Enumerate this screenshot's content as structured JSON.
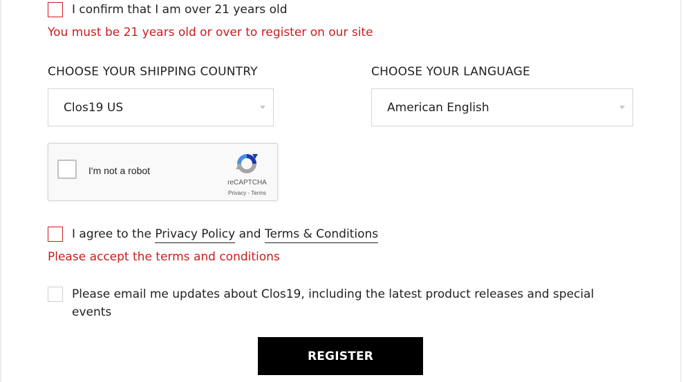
{
  "age_confirm": {
    "label": "I confirm that I am over 21 years old",
    "error": "You must be 21 years old or over to register on our site"
  },
  "shipping_country": {
    "heading": "CHOOSE YOUR SHIPPING COUNTRY",
    "selected": "Clos19 US"
  },
  "language": {
    "heading": "CHOOSE YOUR LANGUAGE",
    "selected": "American English"
  },
  "recaptcha": {
    "label": "I'm not a robot",
    "brand": "reCAPTCHA",
    "privacy": "Privacy",
    "separator": " - ",
    "terms": "Terms",
    "icon": "recaptcha-logo-icon"
  },
  "terms_agree": {
    "prefix": "I agree to the ",
    "privacy_link": "Privacy Policy",
    "middle": " and ",
    "terms_link": "Terms & Conditions",
    "error": "Please accept the terms and conditions"
  },
  "newsletter": {
    "label": "Please email me updates about Clos19, including the latest product releases and special events"
  },
  "register_button": "REGISTER",
  "colors": {
    "error": "#c81c1c",
    "button_bg": "#000000",
    "button_text": "#ffffff"
  }
}
